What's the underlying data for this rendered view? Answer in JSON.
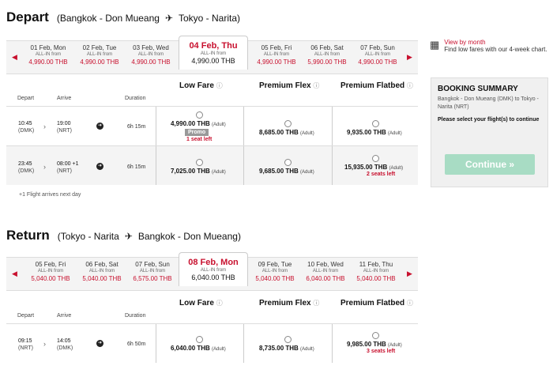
{
  "depart": {
    "label": "Depart",
    "from": "(Bangkok - Don Mueang",
    "to": "Tokyo - Narita)",
    "dates": [
      {
        "label": "01 Feb, Mon",
        "sub": "ALL-IN from",
        "price": "4,990.00 THB"
      },
      {
        "label": "02 Feb, Tue",
        "sub": "ALL-IN from",
        "price": "4,990.00 THB"
      },
      {
        "label": "03 Feb, Wed",
        "sub": "ALL-IN from",
        "price": "4,990.00 THB"
      },
      {
        "label": "04 Feb, Thu",
        "sub": "ALL-IN from",
        "price": "4,990.00 THB"
      },
      {
        "label": "05 Feb, Fri",
        "sub": "ALL-IN from",
        "price": "4,990.00 THB"
      },
      {
        "label": "06 Feb, Sat",
        "sub": "ALL-IN from",
        "price": "5,990.00 THB"
      },
      {
        "label": "07 Feb, Sun",
        "sub": "ALL-IN from",
        "price": "4,990.00 THB"
      }
    ],
    "fares": {
      "low": "Low Fare",
      "flex": "Premium Flex",
      "flatbed": "Premium Flatbed",
      "info": "i"
    },
    "cols": {
      "depart": "Depart",
      "arrive": "Arrive",
      "duration": "Duration"
    },
    "flights": [
      {
        "dep_time": "10:45",
        "dep_ap": "(DMK)",
        "arr_time": "19:00",
        "arr_ap": "(NRT)",
        "arr_plus": "",
        "duration": "6h 15m",
        "low": "4,990.00 THB",
        "flex": "8,685.00 THB",
        "flat": "9,935.00 THB",
        "adult": "(Adult)",
        "promo": "Promo",
        "low_seats": "1 seat left",
        "flat_seats": ""
      },
      {
        "dep_time": "23:45",
        "dep_ap": "(DMK)",
        "arr_time": "08:00",
        "arr_ap": "(NRT)",
        "arr_plus": "+1",
        "duration": "6h 15m",
        "low": "7,025.00 THB",
        "flex": "9,685.00 THB",
        "flat": "15,935.00 THB",
        "adult": "(Adult)",
        "promo": "",
        "low_seats": "",
        "flat_seats": "2 seats left"
      }
    ],
    "note": "+1 Flight arrives next day"
  },
  "view_by_month": {
    "title": "View by month",
    "desc": "Find low fares with our 4-week chart."
  },
  "summary": {
    "title": "BOOKING SUMMARY",
    "route": "Bangkok - Don Mueang (DMK) to Tokyo - Narita (NRT)",
    "select": "Please select your flight(s) to continue",
    "continue": "Continue »"
  },
  "return": {
    "label": "Return",
    "from": "(Tokyo - Narita",
    "to": "Bangkok - Don Mueang)",
    "dates": [
      {
        "label": "05 Feb, Fri",
        "sub": "ALL-IN from",
        "price": "5,040.00 THB"
      },
      {
        "label": "06 Feb, Sat",
        "sub": "ALL-IN from",
        "price": "5,040.00 THB"
      },
      {
        "label": "07 Feb, Sun",
        "sub": "ALL-IN from",
        "price": "6,575.00 THB"
      },
      {
        "label": "08 Feb, Mon",
        "sub": "ALL-IN from",
        "price": "6,040.00 THB"
      },
      {
        "label": "09 Feb, Tue",
        "sub": "ALL-IN from",
        "price": "5,040.00 THB"
      },
      {
        "label": "10 Feb, Wed",
        "sub": "ALL-IN from",
        "price": "6,040.00 THB"
      },
      {
        "label": "11 Feb, Thu",
        "sub": "ALL-IN from",
        "price": "5,040.00 THB"
      }
    ],
    "fares": {
      "low": "Low Fare",
      "flex": "Premium Flex",
      "flatbed": "Premium Flatbed",
      "info": "i"
    },
    "cols": {
      "depart": "Depart",
      "arrive": "Arrive",
      "duration": "Duration"
    },
    "flights": [
      {
        "dep_time": "09:15",
        "dep_ap": "(NRT)",
        "arr_time": "14:05",
        "arr_ap": "(DMK)",
        "arr_plus": "",
        "duration": "6h 50m",
        "low": "6,040.00 THB",
        "flex": "8,735.00 THB",
        "flat": "9,985.00 THB",
        "adult": "(Adult)",
        "promo": "",
        "low_seats": "",
        "flat_seats": "3 seats left"
      }
    ]
  },
  "icons": {
    "plane": "plane-icon",
    "prev": "left-arrow-icon",
    "next": "right-arrow-icon",
    "calendar": "calendar-icon",
    "details": "flight-details-icon",
    "chevron": "chevron-right-icon"
  },
  "colors": {
    "accent": "#c8102e",
    "continue": "#a8dcc4"
  }
}
